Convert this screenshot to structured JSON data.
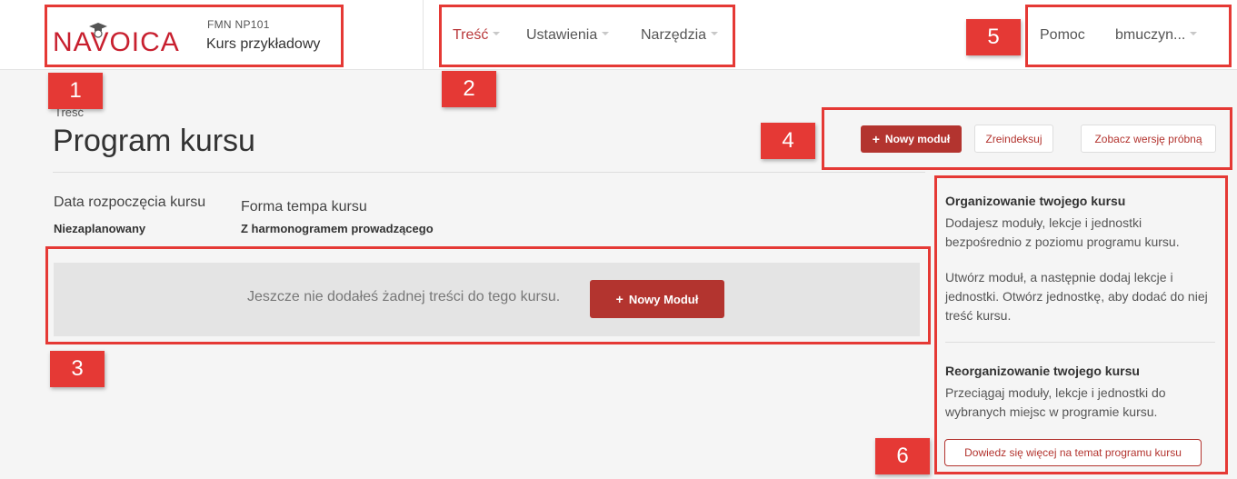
{
  "header": {
    "logo_text": "NAVOICA",
    "course_code": "FMN  NP101",
    "course_name": "Kurs przykładowy",
    "nav": [
      {
        "label": "Treść"
      },
      {
        "label": "Ustawienia"
      },
      {
        "label": "Narzędzia"
      }
    ],
    "help_label": "Pomoc",
    "user_label": "bmuczyn..."
  },
  "annotations": [
    "1",
    "2",
    "3",
    "4",
    "5",
    "6"
  ],
  "page": {
    "subtitle": "Treść",
    "title": "Program kursu",
    "actions": {
      "new_module": "Nowy moduł",
      "reindex": "Zreindeksuj",
      "preview": "Zobacz wersję próbną"
    },
    "start_date_label": "Data rozpoczęcia kursu",
    "start_date_value": "Niezaplanowany",
    "pace_label": "Forma tempa kursu",
    "pace_value": "Z harmonogramem prowadzącego",
    "empty_message": "Jeszcze nie dodałeś żadnej treści do tego kursu.",
    "empty_button": "Nowy Moduł"
  },
  "sidebar": {
    "section1_title": "Organizowanie twojego kursu",
    "section1_text1": "Dodajesz moduły, lekcje i jednostki bezpośrednio z poziomu programu kursu.",
    "section1_text2": "Utwórz moduł, a następnie dodaj lekcje i jednostki. Otwórz jednostkę, aby dodać do niej treść kursu.",
    "section2_title": "Reorganizowanie twojego kursu",
    "section2_text": "Przeciągaj moduły, lekcje i jednostki do wybranych miejsc w programie kursu.",
    "learn_more": "Dowiedz się więcej na temat programu kursu"
  },
  "colors": {
    "brand": "#b3342f",
    "annotation": "#e53935"
  }
}
